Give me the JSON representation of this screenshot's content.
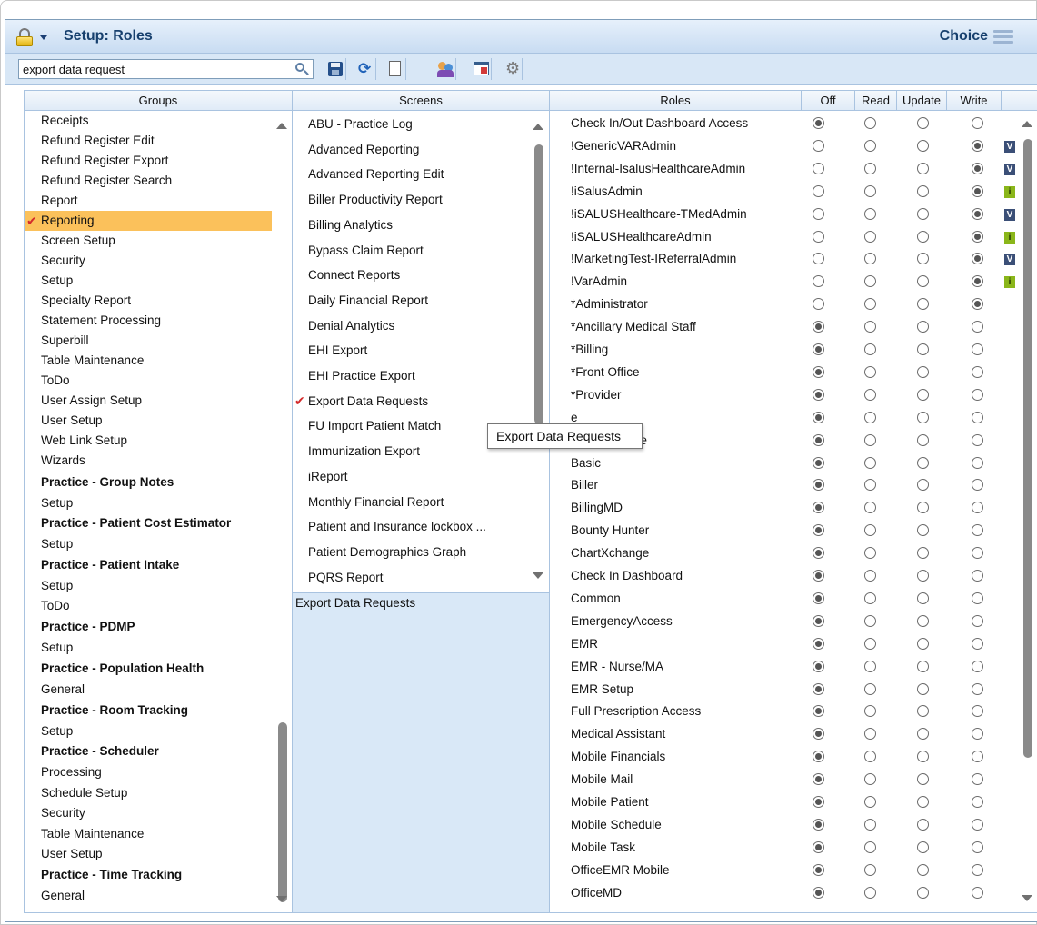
{
  "header": {
    "title": "Setup: Roles",
    "choice_label": "Choice"
  },
  "toolbar": {
    "search_value": "export data request",
    "icons": [
      "magnifier-icon",
      "save-icon",
      "refresh-icon",
      "new-document-icon",
      "users-icon",
      "window-icon",
      "gear-icon"
    ]
  },
  "columns": {
    "groups": "Groups",
    "screens": "Screens",
    "roles": "Roles",
    "off": "Off",
    "read": "Read",
    "update": "Update",
    "write": "Write"
  },
  "groups": [
    {
      "label": "Receipts",
      "bold": false
    },
    {
      "label": "Refund Register Edit",
      "bold": false
    },
    {
      "label": "Refund Register Export",
      "bold": false
    },
    {
      "label": "Refund Register Search",
      "bold": false
    },
    {
      "label": "Report",
      "bold": false
    },
    {
      "label": "Reporting",
      "bold": false,
      "selected": true
    },
    {
      "label": "Screen Setup",
      "bold": false
    },
    {
      "label": "Security",
      "bold": false
    },
    {
      "label": "Setup",
      "bold": false
    },
    {
      "label": "Specialty Report",
      "bold": false
    },
    {
      "label": "Statement Processing",
      "bold": false
    },
    {
      "label": "Superbill",
      "bold": false
    },
    {
      "label": "Table Maintenance",
      "bold": false
    },
    {
      "label": "ToDo",
      "bold": false
    },
    {
      "label": "User Assign Setup",
      "bold": false
    },
    {
      "label": "User Setup",
      "bold": false
    },
    {
      "label": "Web Link Setup",
      "bold": false
    },
    {
      "label": "Wizards",
      "bold": false
    },
    {
      "label": "Practice - Group Notes",
      "bold": true
    },
    {
      "label": "Setup",
      "bold": false
    },
    {
      "label": "Practice - Patient Cost Estimator",
      "bold": true
    },
    {
      "label": "Setup",
      "bold": false
    },
    {
      "label": "Practice - Patient Intake",
      "bold": true
    },
    {
      "label": "Setup",
      "bold": false
    },
    {
      "label": "ToDo",
      "bold": false
    },
    {
      "label": "Practice - PDMP",
      "bold": true
    },
    {
      "label": "Setup",
      "bold": false
    },
    {
      "label": "Practice - Population Health",
      "bold": true
    },
    {
      "label": "General",
      "bold": false
    },
    {
      "label": "Practice - Room Tracking",
      "bold": true
    },
    {
      "label": "Setup",
      "bold": false
    },
    {
      "label": "Practice - Scheduler",
      "bold": true
    },
    {
      "label": "Processing",
      "bold": false
    },
    {
      "label": "Schedule Setup",
      "bold": false
    },
    {
      "label": "Security",
      "bold": false
    },
    {
      "label": "Table Maintenance",
      "bold": false
    },
    {
      "label": "User Setup",
      "bold": false
    },
    {
      "label": "Practice - Time Tracking",
      "bold": true
    },
    {
      "label": "General",
      "bold": false
    }
  ],
  "screens": [
    {
      "label": "ABU - Practice Log"
    },
    {
      "label": "Advanced Reporting"
    },
    {
      "label": "Advanced Reporting Edit"
    },
    {
      "label": "Biller Productivity Report"
    },
    {
      "label": "Billing Analytics"
    },
    {
      "label": "Bypass Claim Report"
    },
    {
      "label": "Connect Reports"
    },
    {
      "label": "Daily Financial Report"
    },
    {
      "label": "Denial Analytics"
    },
    {
      "label": "EHI Export"
    },
    {
      "label": "EHI Practice Export"
    },
    {
      "label": "Export Data Requests",
      "selected": true
    },
    {
      "label": "FU Import Patient Match"
    },
    {
      "label": "Immunization Export"
    },
    {
      "label": "iReport"
    },
    {
      "label": "Monthly Financial Report"
    },
    {
      "label": "Patient and Insurance lockbox ..."
    },
    {
      "label": "Patient Demographics Graph"
    },
    {
      "label": "PQRS Report"
    }
  ],
  "screen_description": "Export Data Requests",
  "tooltip": "Export Data Requests",
  "roles": [
    {
      "name": "Check In/Out Dashboard Access",
      "level": "off",
      "badge": ""
    },
    {
      "name": "!GenericVARAdmin",
      "level": "write",
      "badge": "V"
    },
    {
      "name": "!Internal-IsalusHealthcareAdmin",
      "level": "write",
      "badge": "V"
    },
    {
      "name": "!iSalusAdmin",
      "level": "write",
      "badge": "i"
    },
    {
      "name": "!iSALUSHealthcare-TMedAdmin",
      "level": "write",
      "badge": "V"
    },
    {
      "name": "!iSALUSHealthcareAdmin",
      "level": "write",
      "badge": "i"
    },
    {
      "name": "!MarketingTest-IReferralAdmin",
      "level": "write",
      "badge": "V"
    },
    {
      "name": "!VarAdmin",
      "level": "write",
      "badge": "i"
    },
    {
      "name": "*Administrator",
      "level": "write",
      "badge": ""
    },
    {
      "name": "*Ancillary Medical Staff",
      "level": "off",
      "badge": ""
    },
    {
      "name": "*Billing",
      "level": "off",
      "badge": ""
    },
    {
      "name": "*Front Office",
      "level": "off",
      "badge": ""
    },
    {
      "name": "*Provider",
      "level": "off",
      "badge": ""
    },
    {
      "name": "e",
      "level": "off",
      "badge": ""
    },
    {
      "name": "re Standalone",
      "level": "off",
      "badge": ""
    },
    {
      "name": "Basic",
      "level": "off",
      "badge": ""
    },
    {
      "name": "Biller",
      "level": "off",
      "badge": ""
    },
    {
      "name": "BillingMD",
      "level": "off",
      "badge": ""
    },
    {
      "name": "Bounty Hunter",
      "level": "off",
      "badge": ""
    },
    {
      "name": "ChartXchange",
      "level": "off",
      "badge": ""
    },
    {
      "name": "Check In Dashboard",
      "level": "off",
      "badge": ""
    },
    {
      "name": "Common",
      "level": "off",
      "badge": ""
    },
    {
      "name": "EmergencyAccess",
      "level": "off",
      "badge": ""
    },
    {
      "name": "EMR",
      "level": "off",
      "badge": ""
    },
    {
      "name": "EMR - Nurse/MA",
      "level": "off",
      "badge": ""
    },
    {
      "name": "EMR Setup",
      "level": "off",
      "badge": ""
    },
    {
      "name": "Full Prescription Access",
      "level": "off",
      "badge": ""
    },
    {
      "name": "Medical Assistant",
      "level": "off",
      "badge": ""
    },
    {
      "name": "Mobile Financials",
      "level": "off",
      "badge": ""
    },
    {
      "name": "Mobile Mail",
      "level": "off",
      "badge": ""
    },
    {
      "name": "Mobile Patient",
      "level": "off",
      "badge": ""
    },
    {
      "name": "Mobile Schedule",
      "level": "off",
      "badge": ""
    },
    {
      "name": "Mobile Task",
      "level": "off",
      "badge": ""
    },
    {
      "name": "OfficeEMR Mobile",
      "level": "off",
      "badge": ""
    },
    {
      "name": "OfficeMD",
      "level": "off",
      "badge": ""
    }
  ],
  "colors": {
    "title_text": "#17406e",
    "selected_group": "#fbc15b",
    "check_mark": "#d42b2b",
    "badge_v": "#3b4f77",
    "badge_i": "#8ab61a"
  }
}
